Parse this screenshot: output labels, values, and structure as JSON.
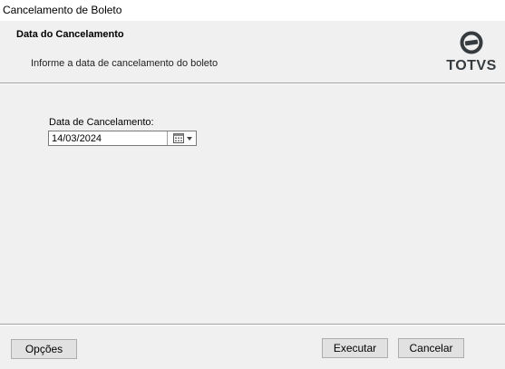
{
  "window": {
    "title": "Cancelamento de Boleto"
  },
  "header": {
    "title": "Data do Cancelamento",
    "subtitle": "Informe a data de cancelamento do boleto",
    "logo_text": "TOTVS"
  },
  "form": {
    "date_label": "Data de Cancelamento:",
    "date_value": "14/03/2024"
  },
  "footer": {
    "options_label": "Opções",
    "execute_label": "Executar",
    "cancel_label": "Cancelar"
  },
  "icons": {
    "calendar": "calendar-icon",
    "dropdown": "chevron-down-icon",
    "logo": "totvs-logo-icon"
  }
}
